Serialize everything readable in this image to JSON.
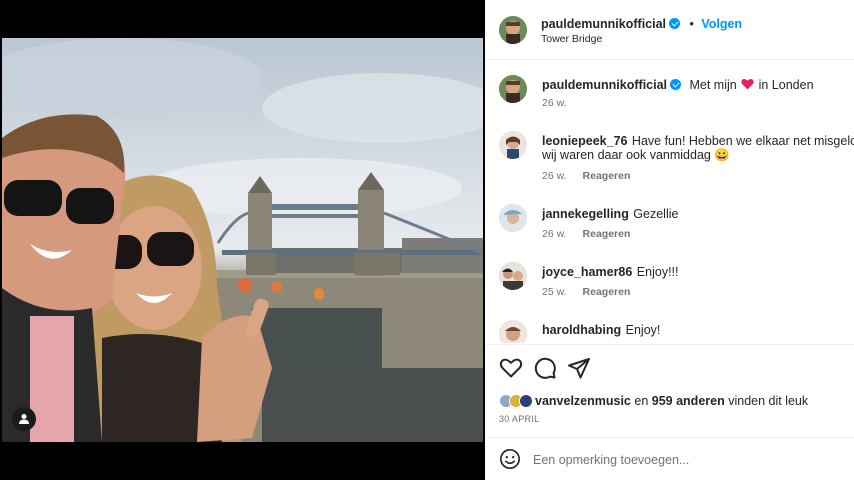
{
  "post": {
    "username": "pauldemunnikofficial",
    "follow_label": "Volgen",
    "separator": "•",
    "location": "Tower Bridge",
    "caption_pre": "Met mijn",
    "caption_post": "in Londen",
    "caption_time": "26 w."
  },
  "comments": [
    {
      "user": "leoniepeek_76",
      "line1": "Have fun! Hebben we elkaar net misgelopen",
      "line2": "wij waren daar ook vanmiddag 😀",
      "time": "26 w.",
      "reply": "Reageren"
    },
    {
      "user": "jannekegelling",
      "line1": "Gezellie",
      "time": "26 w.",
      "reply": "Reageren"
    },
    {
      "user": "joyce_hamer86",
      "line1": "Enjoy!!!",
      "time": "25 w.",
      "reply": "Reageren"
    },
    {
      "user": "haroldhabing",
      "line1": "Enjoy!"
    }
  ],
  "likes": {
    "user": "vanvelzenmusic",
    "joiner": "en",
    "others": "959 anderen",
    "suffix": "vinden dit leuk"
  },
  "date": "30 APRIL",
  "comment_input": {
    "placeholder": "Een opmerking toevoegen..."
  },
  "colors": {
    "accent": "#0095f6",
    "heart": "#ed4956"
  },
  "icons": [
    "heart-icon",
    "comment-icon",
    "share-icon",
    "emoji-icon",
    "tag-user-icon",
    "verified-icon"
  ]
}
